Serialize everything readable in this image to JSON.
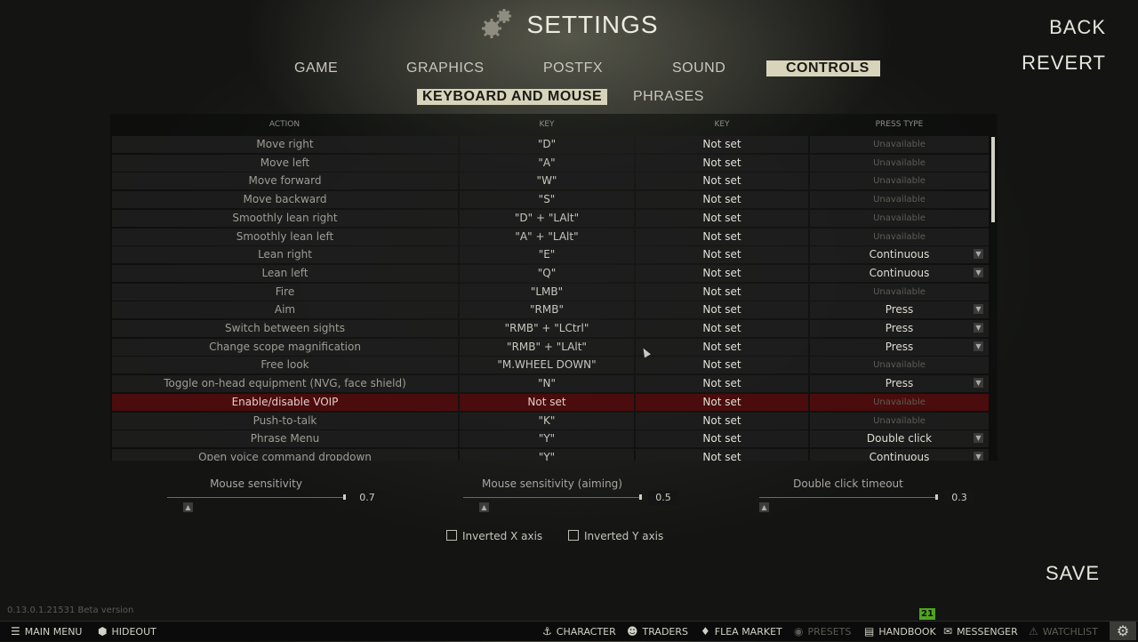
{
  "header": {
    "title": "SETTINGS",
    "back": "BACK",
    "revert": "REVERT"
  },
  "tabs": [
    "GAME",
    "GRAPHICS",
    "POSTFX",
    "SOUND",
    "CONTROLS"
  ],
  "active_tab": "CONTROLS",
  "subtabs": [
    "KEYBOARD AND MOUSE",
    "PHRASES"
  ],
  "active_subtab": "KEYBOARD AND MOUSE",
  "table": {
    "headers": [
      "ACTION",
      "KEY",
      "KEY",
      "PRESS TYPE"
    ],
    "rows": [
      {
        "action": "Move right",
        "key1": "\"D\"",
        "key2": "Not set",
        "press": "Unavailable"
      },
      {
        "action": "Move left",
        "key1": "\"A\"",
        "key2": "Not set",
        "press": "Unavailable"
      },
      {
        "action": "Move forward",
        "key1": "\"W\"",
        "key2": "Not set",
        "press": "Unavailable"
      },
      {
        "action": "Move backward",
        "key1": "\"S\"",
        "key2": "Not set",
        "press": "Unavailable"
      },
      {
        "action": "Smoothly lean right",
        "key1": "\"D\" + \"LAlt\"",
        "key2": "Not set",
        "press": "Unavailable"
      },
      {
        "action": "Smoothly lean left",
        "key1": "\"A\" + \"LAlt\"",
        "key2": "Not set",
        "press": "Unavailable"
      },
      {
        "action": "Lean right",
        "key1": "\"E\"",
        "key2": "Not set",
        "press": "Continuous"
      },
      {
        "action": "Lean left",
        "key1": "\"Q\"",
        "key2": "Not set",
        "press": "Continuous"
      },
      {
        "action": "Fire",
        "key1": "\"LMB\"",
        "key2": "Not set",
        "press": "Unavailable"
      },
      {
        "action": "Aim",
        "key1": "\"RMB\"",
        "key2": "Not set",
        "press": "Press"
      },
      {
        "action": "Switch between sights",
        "key1": "\"RMB\" + \"LCtrl\"",
        "key2": "Not set",
        "press": "Press"
      },
      {
        "action": "Change scope magnification",
        "key1": "\"RMB\" + \"LAlt\"",
        "key2": "Not set",
        "press": "Press"
      },
      {
        "action": "Free look",
        "key1": "\"M.WHEEL DOWN\"",
        "key2": "Not set",
        "press": "Unavailable"
      },
      {
        "action": "Toggle on-head equipment (NVG, face shield)",
        "key1": "\"N\"",
        "key2": "Not set",
        "press": "Press"
      },
      {
        "action": "Enable/disable VOIP",
        "key1": "Not set",
        "key2": "Not set",
        "press": "Unavailable",
        "highlight": true
      },
      {
        "action": "Push-to-talk",
        "key1": "\"K\"",
        "key2": "Not set",
        "press": "Unavailable"
      },
      {
        "action": "Phrase Menu",
        "key1": "\"Y\"",
        "key2": "Not set",
        "press": "Double click"
      },
      {
        "action": "Open voice command dropdown",
        "key1": "\"Y\"",
        "key2": "Not set",
        "press": "Continuous"
      }
    ]
  },
  "sliders": [
    {
      "label": "Mouse sensitivity",
      "value": "0.7"
    },
    {
      "label": "Mouse sensitivity (aiming)",
      "value": "0.5"
    },
    {
      "label": "Double click timeout",
      "value": "0.3"
    }
  ],
  "checkboxes": [
    {
      "label": "Inverted X axis",
      "checked": false
    },
    {
      "label": "Inverted Y axis",
      "checked": false
    }
  ],
  "footer": {
    "version": "0.13.0.1.21531 Beta version",
    "save": "SAVE"
  },
  "bottombar": {
    "main_menu": "MAIN MENU",
    "hideout": "HIDEOUT",
    "character": "CHARACTER",
    "traders": "TRADERS",
    "flea_market": "FLEA MARKET",
    "presets": "PRESETS",
    "handbook": "HANDBOOK",
    "messenger": "MESSENGER",
    "messenger_badge": "21",
    "watchlist": "WATCHLIST"
  },
  "icons": {
    "gear": "gear-icon",
    "menu": "hamburger-icon",
    "hideout": "hexagon-icon",
    "character": "anchor-icon",
    "traders": "people-icon",
    "flea": "tag-icon",
    "presets": "presets-icon",
    "handbook": "book-icon",
    "messenger": "chat-icon",
    "watchlist": "warning-icon",
    "settings": "gear-icon"
  },
  "colors": {
    "active_tab_bg": "#d8d4bb",
    "highlight_row": "#4a0c0c",
    "badge": "#4ea51e"
  }
}
